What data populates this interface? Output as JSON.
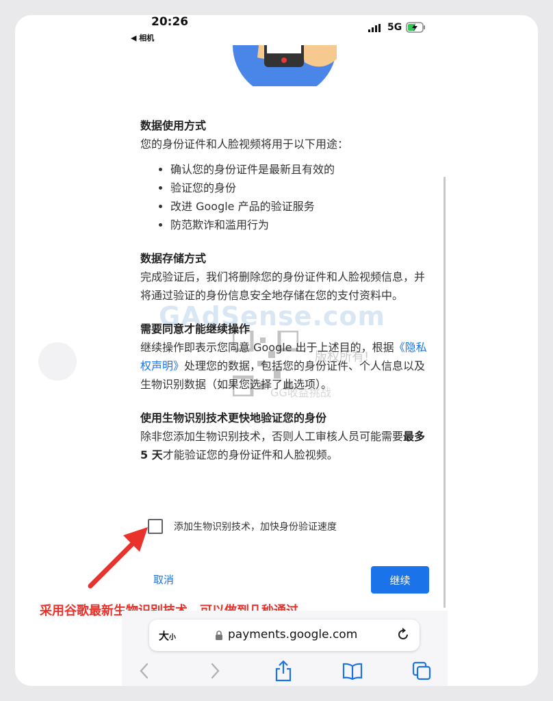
{
  "status_bar": {
    "time": "20:26",
    "back_app": "◀ 相机",
    "network": "5G"
  },
  "sections": {
    "usage": {
      "title": "数据使用方式",
      "intro": "您的身份证件和人脸视频将用于以下用途：",
      "items": [
        "确认您的身份证件是最新且有效的",
        "验证您的身份",
        "改进 Google 产品的验证服务",
        "防范欺诈和滥用行为"
      ]
    },
    "storage": {
      "title": "数据存储方式",
      "body": "完成验证后，我们将删除您的身份证件和人脸视频信息，并将通过验证的身份信息安全地存储在您的支付资料中。"
    },
    "consent": {
      "title": "需要同意才能继续操作",
      "body_before": "继续操作即表示您同意 Google 出于上述目的，根据",
      "link": "《隐私权声明》",
      "body_after": "处理您的数据，包括您的身份证件、个人信息以及生物识别数据（如果您选择了此选项）。"
    },
    "biometric": {
      "title": "使用生物识别技术更快地验证您的身份",
      "body_before": "除非您添加生物识别技术，否则人工审核人员可能需要",
      "bold": "最多 5 天",
      "body_after": "才能验证您的身份证件和人脸视频。"
    }
  },
  "checkbox_label": "添加生物识别技术，加快身份验证速度",
  "buttons": {
    "cancel": "取消",
    "continue": "继续"
  },
  "annotation": "采用谷歌最新生物识别技术，可以做到几秒通过",
  "browser": {
    "text_size_big": "大",
    "text_size_small": "小",
    "url": "payments.google.com"
  },
  "watermark": {
    "site": "GAdSense.com",
    "copyright": "版权所有!",
    "sub": "GG收益挑战"
  },
  "colors": {
    "accent": "#1a73e8",
    "annotation": "#e8322b"
  }
}
